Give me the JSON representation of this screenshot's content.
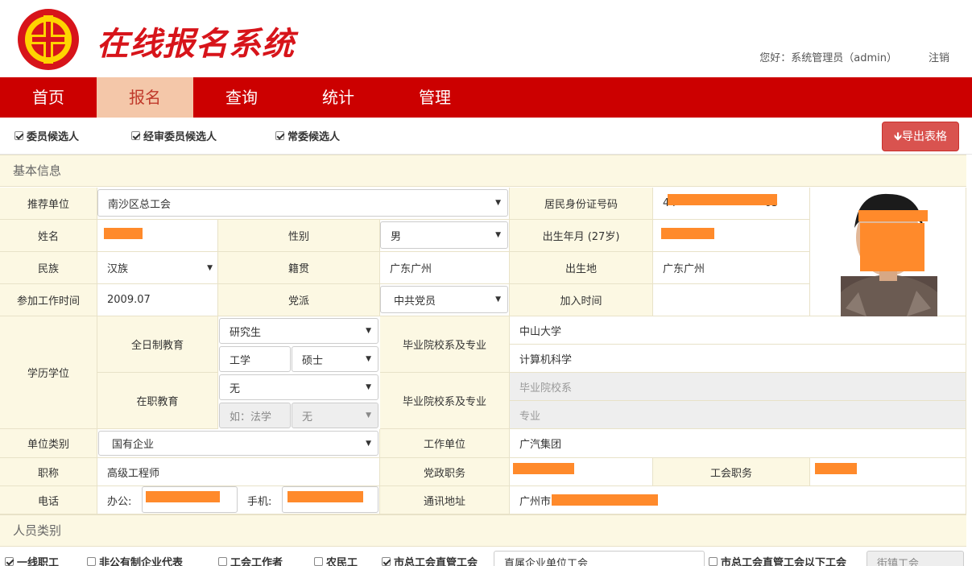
{
  "header": {
    "title": "在线报名系统",
    "greeting": "您好：系统管理员（admin）",
    "logout": "注销"
  },
  "nav": [
    {
      "label": "首页",
      "active": false
    },
    {
      "label": "报名",
      "active": true
    },
    {
      "label": "查询",
      "active": false
    },
    {
      "label": "统计",
      "active": false
    },
    {
      "label": "管理",
      "active": false
    }
  ],
  "options": {
    "committee_candidate": "委员候选人",
    "audit_committee_candidate": "经审委员候选人",
    "standing_committee_candidate": "常委候选人",
    "export_button": "导出表格"
  },
  "sections": {
    "basic_info": "基本信息",
    "personnel_category": "人员类别"
  },
  "form": {
    "recommend_unit_label": "推荐单位",
    "recommend_unit_value": "南沙区总工会",
    "id_number_label": "居民身份证号码",
    "id_number_value": "44",
    "id_number_tail": "63",
    "name_label": "姓名",
    "gender_label": "性别",
    "gender_value": "男",
    "birth_label": "出生年月 (27岁)",
    "ethnicity_label": "民族",
    "ethnicity_value": "汉族",
    "native_label": "籍贯",
    "native_value": "广东广州",
    "birthplace_label": "出生地",
    "birthplace_value": "广东广州",
    "work_start_label": "参加工作时间",
    "work_start_value": "2009.07",
    "party_label": "党派",
    "party_value": "中共党员",
    "join_time_label": "加入时间",
    "education_label": "学历学位",
    "fulltime_label": "全日制教育",
    "fulltime_level": "研究生",
    "fulltime_field": "工学",
    "fulltime_degree": "硕士",
    "grad_school_label": "毕业院校系及专业",
    "fulltime_school": "中山大学",
    "fulltime_major": "计算机科学",
    "inservice_label": "在职教育",
    "inservice_level": "无",
    "inservice_field_placeholder": "如：法学",
    "inservice_degree": "无",
    "grad_school_label2": "毕业院校系及专业",
    "inservice_school_placeholder": "毕业院校系",
    "inservice_major_placeholder": "专业",
    "unit_type_label": "单位类别",
    "unit_type_value": "国有企业",
    "work_unit_label": "工作单位",
    "work_unit_value": "广汽集团",
    "title_label": "职称",
    "title_value": "高级工程师",
    "party_post_label": "党政职务",
    "union_post_label": "工会职务",
    "phone_label": "电话",
    "office_label": "办公:",
    "mobile_label": "手机:",
    "address_label": "通讯地址",
    "address_value": "广州市"
  },
  "bottom_row": [
    "一线职工",
    "非公有制企业代表",
    "工会工作者",
    "农民工",
    "市总工会直管工会",
    "直属企业单位工会",
    "市总工会直管工会以下工会",
    "街镇工会"
  ]
}
